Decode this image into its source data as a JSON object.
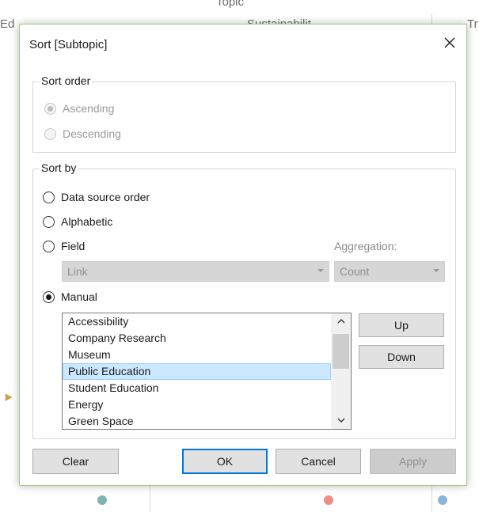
{
  "background": {
    "topic_header": "Topic",
    "left_fragment": "Ed",
    "middle_fragment": "Sustainabilit",
    "right_fragment": "Tr",
    "dot_colors": [
      "#7fb5ad",
      "#f28b82",
      "#8ab4d8"
    ]
  },
  "dialog": {
    "title": "Sort [Subtopic]",
    "close_icon": "close-icon",
    "sort_order": {
      "legend": "Sort order",
      "options": [
        {
          "label": "Ascending",
          "checked": true,
          "enabled": false
        },
        {
          "label": "Descending",
          "checked": false,
          "enabled": false
        }
      ]
    },
    "sort_by": {
      "legend": "Sort by",
      "options": [
        {
          "label": "Data source order",
          "checked": false
        },
        {
          "label": "Alphabetic",
          "checked": false
        },
        {
          "label": "Field",
          "checked": false
        },
        {
          "label": "Manual",
          "checked": true
        }
      ],
      "aggregation_label": "Aggregation:",
      "field_select_value": "Link",
      "aggregation_select_value": "Count",
      "manual_list": [
        "Accessibility",
        "Company Research",
        "Museum",
        "Public Education",
        "Student Education",
        "Energy",
        "Green Space"
      ],
      "selected_item": "Public Education",
      "up_label": "Up",
      "down_label": "Down"
    },
    "buttons": {
      "clear": "Clear",
      "ok": "OK",
      "cancel": "Cancel",
      "apply": "Apply"
    },
    "colors": {
      "accent": "#0078d7",
      "selection": "#cce8ff",
      "border": "#a6c98a"
    }
  }
}
